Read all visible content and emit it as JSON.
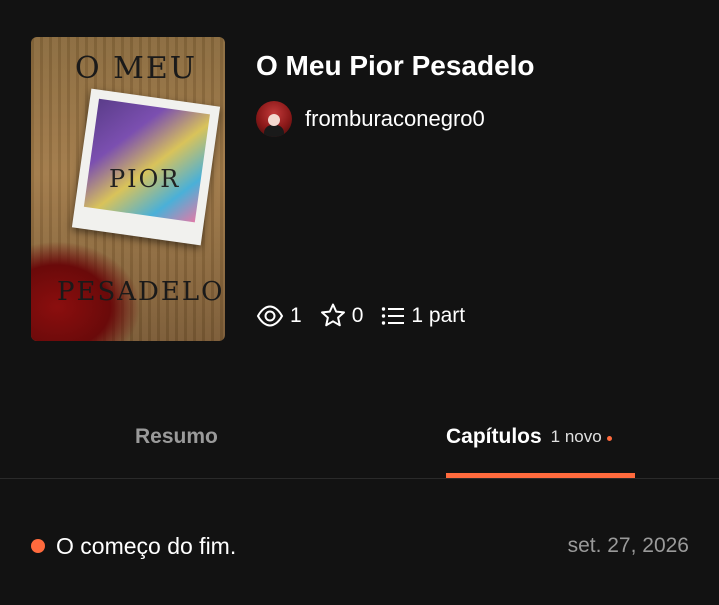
{
  "story": {
    "title": "O Meu Pior Pesadelo",
    "cover_text_top": "O MEU",
    "cover_text_mid": "PIOR",
    "cover_text_bottom": "PESADELO",
    "author": "fromburaconegro0",
    "stats": {
      "reads": "1",
      "votes": "0",
      "parts": "1 part"
    }
  },
  "icons": {
    "reads": "eye-icon",
    "votes": "star-icon",
    "parts": "list-icon"
  },
  "tabs": [
    {
      "label": "Resumo",
      "active": false
    },
    {
      "label": "Capítulos",
      "badge": "1 novo",
      "active": true
    }
  ],
  "chapters": [
    {
      "title": "O começo do fim.",
      "date": "set. 27, 2026",
      "new": true
    }
  ],
  "colors": {
    "background": "#121212",
    "accent": "#ff6a3d",
    "muted": "#9a9a9a"
  }
}
